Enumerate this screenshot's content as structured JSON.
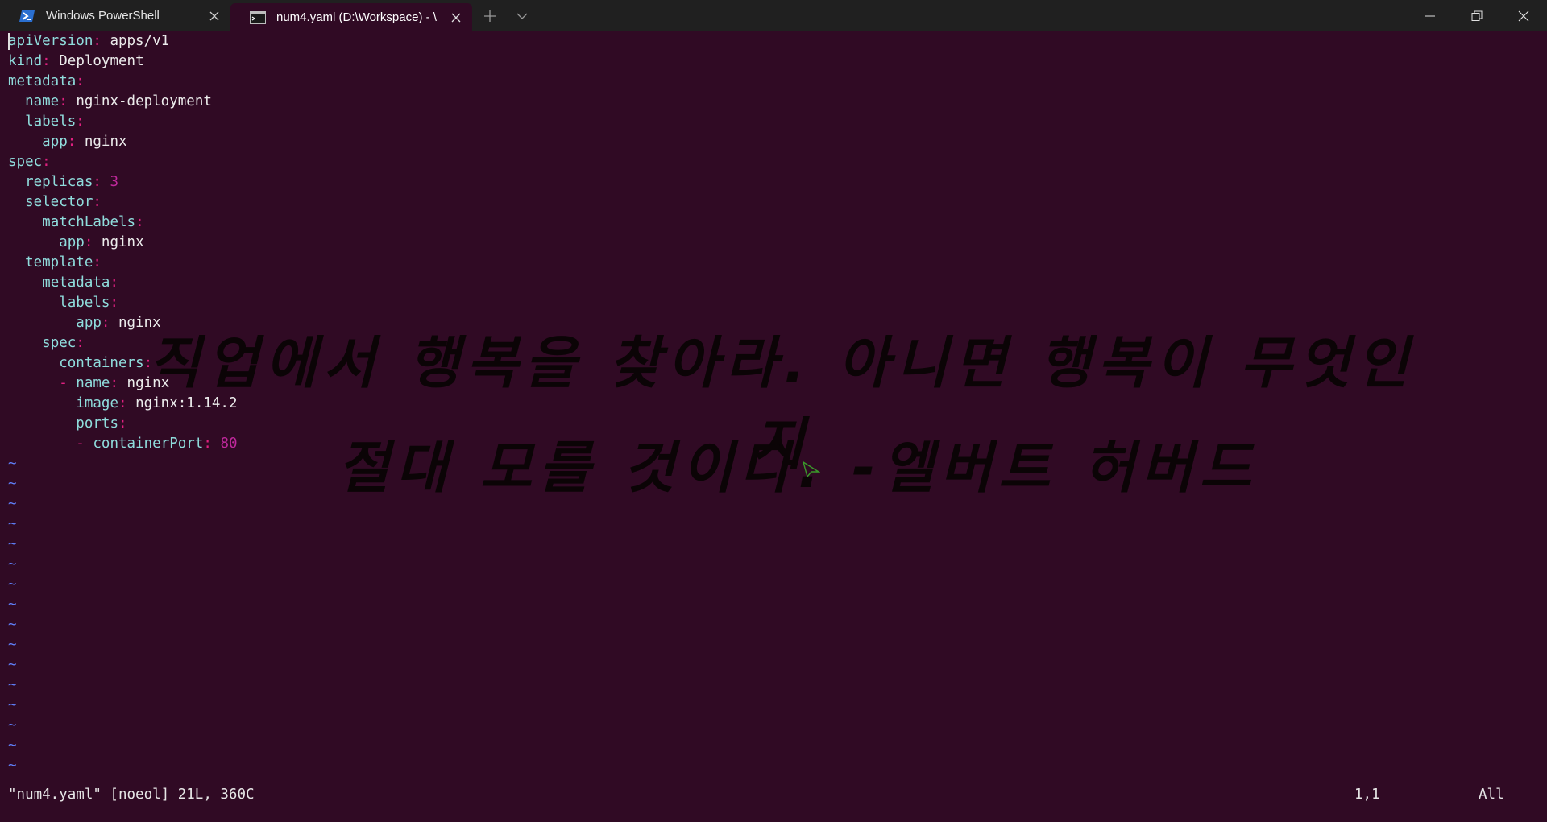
{
  "tabs": [
    {
      "label": "Windows PowerShell",
      "icon": "powershell-icon",
      "active": false
    },
    {
      "label": "num4.yaml (D:\\Workspace) - \\",
      "icon": "terminal-icon",
      "active": true
    }
  ],
  "window_controls": {
    "minimize": "minimize-icon",
    "maximize": "restore-icon",
    "close": "close-icon"
  },
  "editor": {
    "lines": [
      {
        "indent": "",
        "key": "apiVersion",
        "value": "apps/v1"
      },
      {
        "indent": "",
        "key": "kind",
        "value": "Deployment"
      },
      {
        "indent": "",
        "key": "metadata",
        "value": ""
      },
      {
        "indent": "  ",
        "key": "name",
        "value": "nginx-deployment"
      },
      {
        "indent": "  ",
        "key": "labels",
        "value": ""
      },
      {
        "indent": "    ",
        "key": "app",
        "value": "nginx"
      },
      {
        "indent": "",
        "key": "spec",
        "value": ""
      },
      {
        "indent": "  ",
        "key": "replicas",
        "value": "3",
        "numeric": true
      },
      {
        "indent": "  ",
        "key": "selector",
        "value": ""
      },
      {
        "indent": "    ",
        "key": "matchLabels",
        "value": ""
      },
      {
        "indent": "      ",
        "key": "app",
        "value": "nginx"
      },
      {
        "indent": "  ",
        "key": "template",
        "value": ""
      },
      {
        "indent": "    ",
        "key": "metadata",
        "value": ""
      },
      {
        "indent": "      ",
        "key": "labels",
        "value": ""
      },
      {
        "indent": "        ",
        "key": "app",
        "value": "nginx"
      },
      {
        "indent": "    ",
        "key": "spec",
        "value": ""
      },
      {
        "indent": "      ",
        "key": "containers",
        "value": ""
      },
      {
        "indent": "      ",
        "dash": true,
        "key": "name",
        "value": "nginx"
      },
      {
        "indent": "        ",
        "key": "image",
        "value": "nginx:1.14.2"
      },
      {
        "indent": "        ",
        "key": "ports",
        "value": ""
      },
      {
        "indent": "        ",
        "dash": true,
        "key": "containerPort",
        "value": "80",
        "numeric": true
      }
    ],
    "tilde": "~",
    "tilde_count": 16
  },
  "status": {
    "file": "\"num4.yaml\" [noeol] 21L, 360C",
    "position": "1,1",
    "scroll": "All"
  },
  "wallpaper_quote": {
    "line1": "직업에서 행복을 찾아라. 아니면 행복이 무엇인지",
    "line2": "절대 모를 것이다. -엘버트 허버드"
  },
  "colors": {
    "background": "#300a24",
    "titlebar": "#202020",
    "yaml_key": "#8fdcdc",
    "colon": "#e02080",
    "number": "#c0289c",
    "tilde": "#5f7ef7"
  }
}
